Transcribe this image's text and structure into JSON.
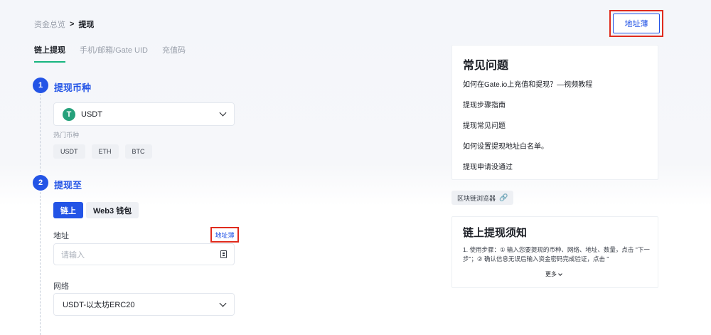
{
  "breadcrumb": {
    "parent": "资金总览",
    "separator": ">",
    "current": "提现"
  },
  "top_address_book_label": "地址薄",
  "tabs": [
    {
      "label": "链上提现",
      "active": true
    },
    {
      "label": "手机/邮箱/Gate UID",
      "active": false
    },
    {
      "label": "充值码",
      "active": false
    }
  ],
  "step1": {
    "number": "1",
    "title": "提现币种"
  },
  "coin_select": {
    "icon_symbol": "T",
    "value": "USDT"
  },
  "hot_coins": {
    "label": "热门币种",
    "items": [
      "USDT",
      "ETH",
      "BTC"
    ]
  },
  "step2": {
    "number": "2",
    "title": "提现至"
  },
  "destination_toggle": {
    "on_chain": "链上",
    "web3": "Web3 钱包"
  },
  "address": {
    "label": "地址",
    "address_book_link": "地址薄",
    "placeholder": "请输入"
  },
  "network": {
    "label": "网络",
    "value": "USDT-以太坊ERC20"
  },
  "faq": {
    "title": "常见问题",
    "items": [
      "如何在Gate.io上充值和提现？—视频教程",
      "提现步骤指南",
      "提现常见问题",
      "如何设置提现地址白名单。",
      "提现申请没通过"
    ]
  },
  "explorer_button": "区块链浏览器",
  "notice": {
    "title": "链上提现须知",
    "text": "1.  使用步骤：① 输入您要提现的币种、网络、地址、数量，点击 \"下一步\"；② 确认信息无误后输入资金密码完成验证，点击 \"",
    "more": "更多"
  },
  "colors": {
    "accent": "#2354e6",
    "tab_underline": "#17b57f",
    "highlight_box": "#e02b1d",
    "tether": "#26a17b"
  }
}
